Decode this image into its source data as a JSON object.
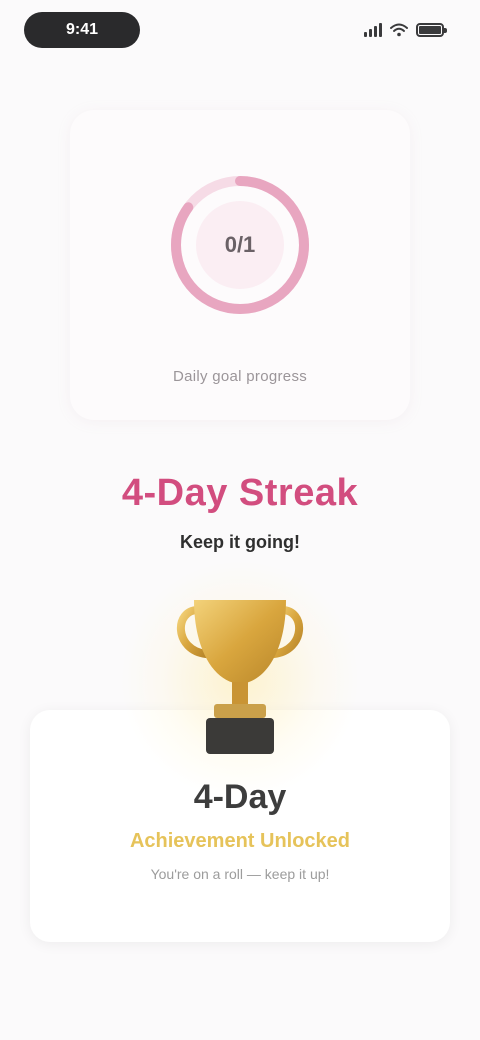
{
  "status_bar": {
    "time": "9:41",
    "icons": [
      "signal-icon",
      "wifi-icon",
      "battery-icon"
    ]
  },
  "hero": {
    "ring_value": "0/1",
    "ring_progress": 0.85,
    "caption": "Daily goal progress",
    "colors": {
      "ring": "#e8a6c0",
      "ring_track": "#f6dbe6"
    }
  },
  "streak": {
    "title": "4-Day Streak",
    "subtitle": "Keep it going!",
    "color": "#d24d7f"
  },
  "achievement": {
    "icon": "trophy-icon",
    "days": "4-Day",
    "title": "Achievement Unlocked",
    "subtitle": "You're on a roll — keep it up!",
    "colors": {
      "gold": "#e6c35a",
      "gold_dark": "#b8862a"
    }
  }
}
